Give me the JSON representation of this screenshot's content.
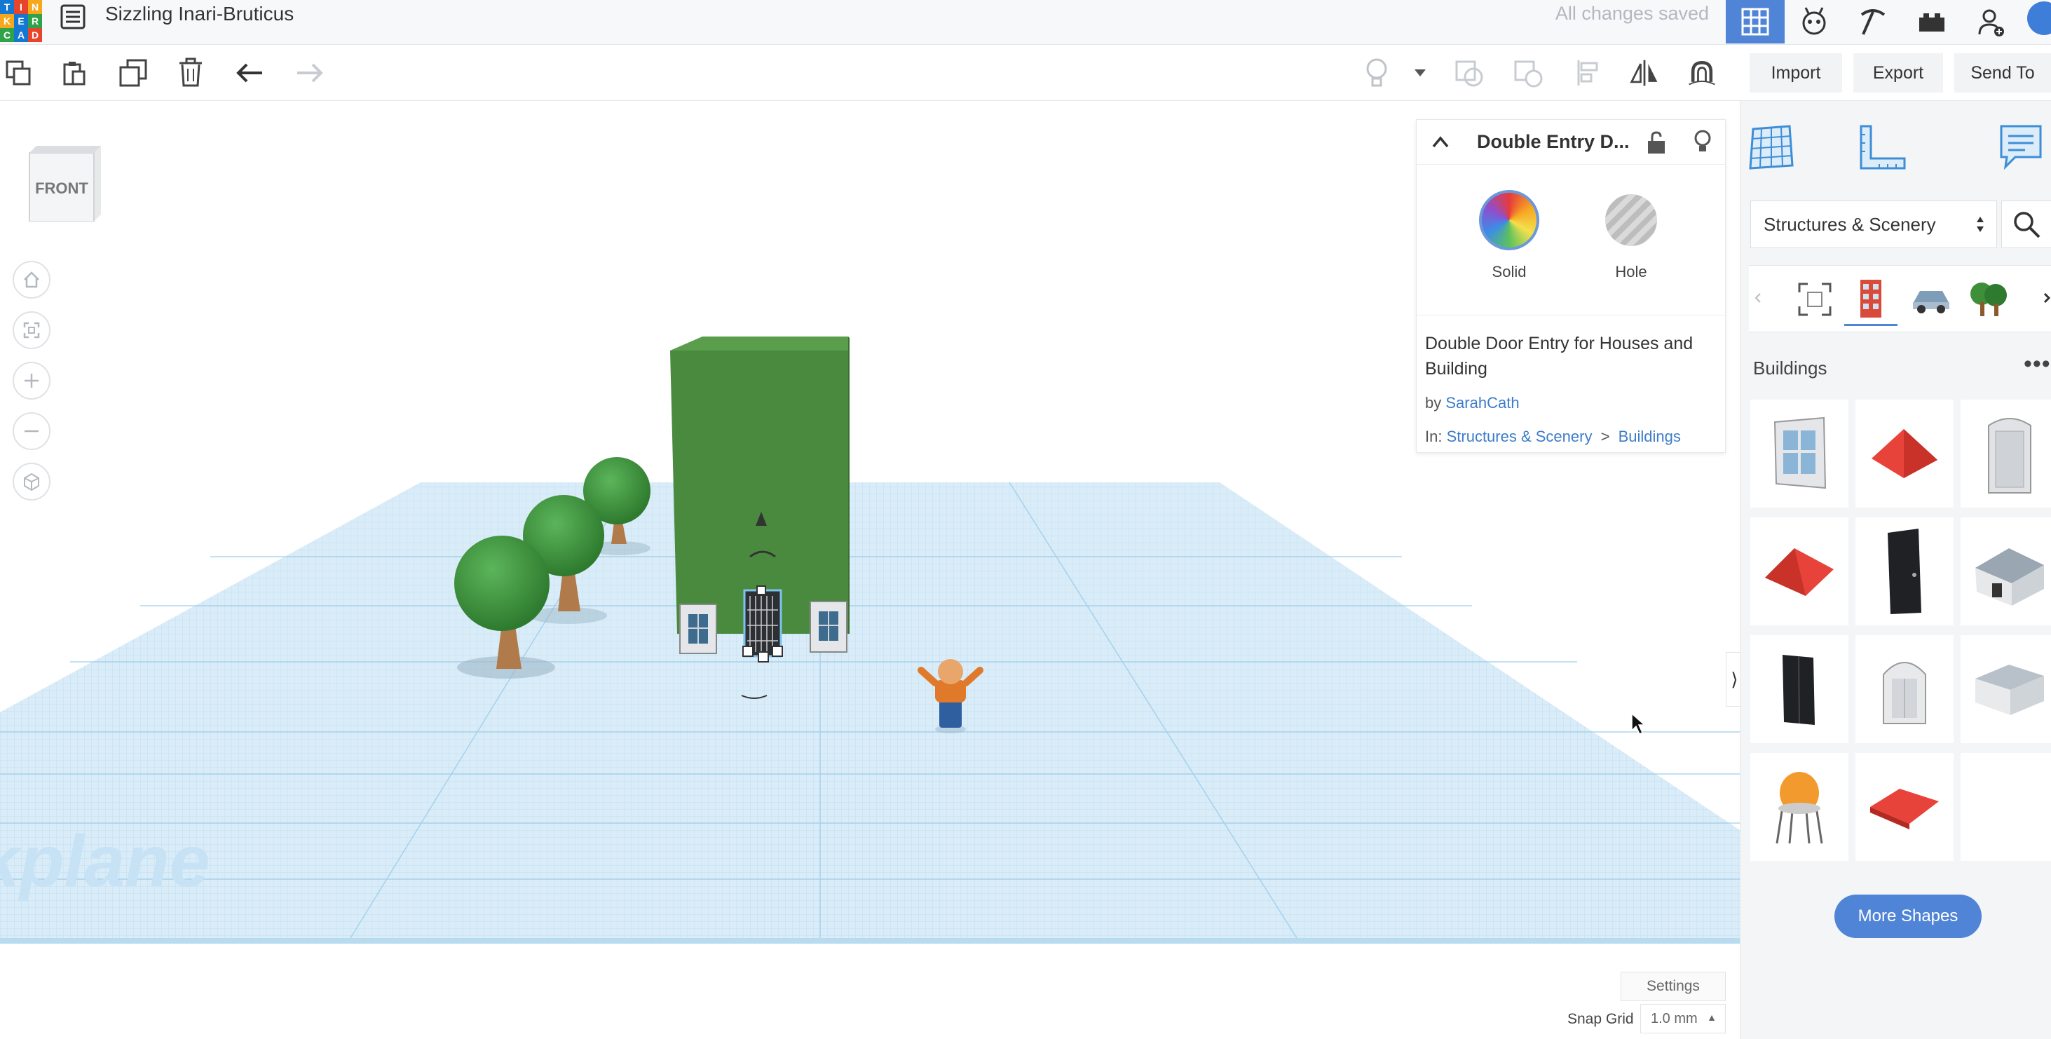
{
  "app": {
    "logo_letters": [
      "T",
      "I",
      "N",
      "K",
      "E",
      "R",
      "C",
      "A",
      "D"
    ],
    "project_title": "Sizzling Inari-Bruticus",
    "save_status": "All changes saved",
    "top_icons": [
      "grid-view-icon",
      "tinkercad-3d-icon",
      "pickaxe-icon",
      "bricks-icon",
      "user-add-icon",
      "profile-avatar-icon"
    ]
  },
  "toolbar": {
    "tools": [
      "copy-icon",
      "paste-icon",
      "duplicate-icon",
      "delete-icon",
      "undo-icon",
      "redo-icon"
    ],
    "right_tools": [
      "light-bulb-icon",
      "dropdown-arrow-icon",
      "group-icon",
      "ungroup-icon",
      "align-icon",
      "mirror-icon",
      "cruise-magnet-icon"
    ]
  },
  "actions": {
    "import": "Import",
    "export": "Export",
    "send_to": "Send To"
  },
  "viewcube": {
    "face": "FRONT"
  },
  "viewport": {
    "nav": [
      "home-view-icon",
      "fit-all-icon",
      "zoom-in-icon",
      "zoom-out-icon",
      "perspective-icon"
    ],
    "workplane_watermark": "kplane",
    "settings_label": "Settings",
    "snap_grid_label": "Snap Grid",
    "snap_grid_value": "1.0 mm"
  },
  "inspector": {
    "title": "Double Entry D...",
    "solid_label": "Solid",
    "hole_label": "Hole",
    "description": "Double Door Entry for Houses and Building",
    "by_prefix": "by",
    "author": "SarahCath",
    "in_prefix": "In:",
    "category": "Structures & Scenery",
    "separator": ">",
    "subcategory": "Buildings"
  },
  "panel": {
    "category_select": "Structures & Scenery",
    "section_title": "Buildings",
    "section_more": "•••",
    "more_shapes": "More Shapes",
    "shapes": [
      "window-shape",
      "red-roof-shape",
      "arched-door-frame-shape",
      "red-gable-roof-shape",
      "black-door-shape",
      "small-house-shape",
      "black-double-door-shape",
      "arched-window-shape",
      "gray-building-shape",
      "water-tower-shape",
      "red-flat-roof-shape"
    ]
  },
  "colors": {
    "accent": "#4f84d6",
    "building_green": "#4a8a3f",
    "grid_blue": "#a8d4ee",
    "link": "#3d7cc9"
  }
}
